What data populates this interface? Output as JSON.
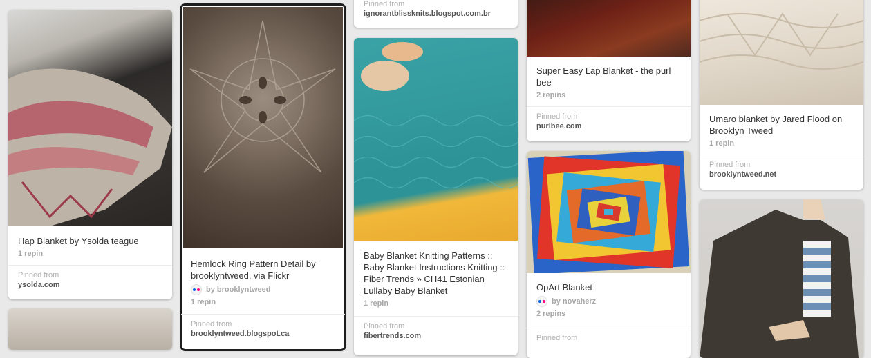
{
  "cards": {
    "c1": {
      "title": "Hap Blanket by Ysolda teague",
      "repins": "1 repin",
      "pinned_label": "Pinned from",
      "source": "ysolda.com"
    },
    "c2": {
      "title": "Hemlock Ring Pattern Detail by brooklyntweed, via Flickr",
      "via": "by brooklyntweed",
      "repins": "1 repin",
      "pinned_label": "Pinned from",
      "source": "brooklyntweed.blogspot.ca"
    },
    "c3top": {
      "pinned_label": "Pinned from",
      "source": "ignorantblissknits.blogspot.com.br"
    },
    "c3": {
      "title": "Baby Blanket Knitting Patterns :: Baby Blanket Instructions Knitting :: Fiber Trends » CH41 Estonian Lullaby Baby Blanket",
      "repins": "1 repin",
      "pinned_label": "Pinned from",
      "source": "fibertrends.com"
    },
    "c4top": {
      "title": "Super Easy Lap Blanket - the purl bee",
      "repins": "2 repins",
      "pinned_label": "Pinned from",
      "source": "purlbee.com"
    },
    "c4": {
      "title": "OpArt Blanket",
      "via": "by novaherz",
      "repins": "2 repins",
      "pinned_label": "Pinned from"
    },
    "c5top": {
      "title": "Umaro blanket by Jared Flood on Brooklyn Tweed",
      "repins": "1 repin",
      "pinned_label": "Pinned from",
      "source": "brooklyntweed.net"
    }
  },
  "colors": {
    "background": "#e9e9e9",
    "card": "#ffffff",
    "muted": "#a8a8a8",
    "flickr_blue": "#0063dc",
    "flickr_pink": "#ff0084"
  }
}
